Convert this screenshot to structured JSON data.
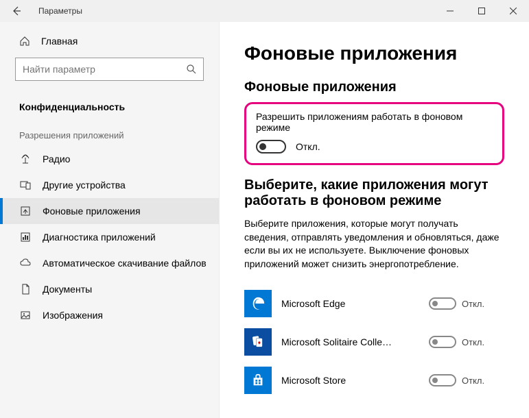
{
  "titlebar": {
    "title": "Параметры"
  },
  "sidebar": {
    "home": "Главная",
    "search_placeholder": "Найти параметр",
    "section": "Конфиденциальность",
    "group": "Разрешения приложений",
    "items": [
      {
        "label": "Радио"
      },
      {
        "label": "Другие устройства"
      },
      {
        "label": "Фоновые приложения"
      },
      {
        "label": "Диагностика приложений"
      },
      {
        "label": "Автоматическое скачивание файлов"
      },
      {
        "label": "Документы"
      },
      {
        "label": "Изображения"
      }
    ]
  },
  "main": {
    "title": "Фоновые приложения",
    "subheading1": "Фоновые приложения",
    "master": {
      "label": "Разрешить приложениям работать в фоновом режиме",
      "state": "Откл."
    },
    "subheading2": "Выберите, какие приложения могут работать в фоновом режиме",
    "description": "Выберите приложения, которые могут получать сведения, отправлять уведомления и обновляться, даже если вы их не используете. Выключение фоновых приложений может снизить энергопотребление.",
    "apps": [
      {
        "name": "Microsoft Edge",
        "state": "Откл."
      },
      {
        "name": "Microsoft Solitaire Colle…",
        "state": "Откл."
      },
      {
        "name": "Microsoft Store",
        "state": "Откл."
      }
    ]
  }
}
